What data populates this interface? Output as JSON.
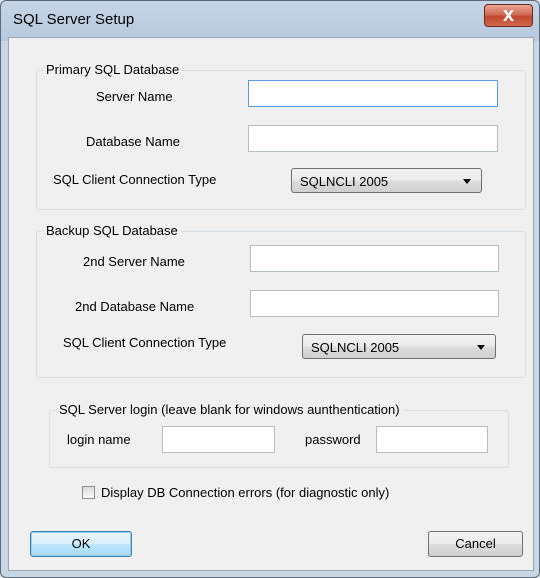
{
  "window": {
    "title": "SQL Server Setup",
    "close_glyph": "X"
  },
  "primary": {
    "legend": "Primary SQL Database",
    "server_name_label": "Server Name",
    "server_name_value": "",
    "database_name_label": "Database Name",
    "database_name_value": "",
    "connection_type_label": "SQL Client Connection  Type",
    "connection_type_value": "SQLNCLI 2005"
  },
  "backup": {
    "legend": "Backup SQL Database",
    "server_name_label": "2nd Server Name",
    "server_name_value": "",
    "database_name_label": "2nd Database Name",
    "database_name_value": "",
    "connection_type_label": "SQL Client Connection  Type",
    "connection_type_value": "SQLNCLI 2005"
  },
  "login": {
    "legend": "SQL Server login (leave blank for windows aunthentication)",
    "login_name_label": "login name",
    "login_name_value": "",
    "password_label": "password",
    "password_value": ""
  },
  "options": {
    "display_errors_label": "Display DB Connection errors (for diagnostic only)",
    "display_errors_checked": false
  },
  "buttons": {
    "ok_label": "OK",
    "cancel_label": "Cancel"
  }
}
